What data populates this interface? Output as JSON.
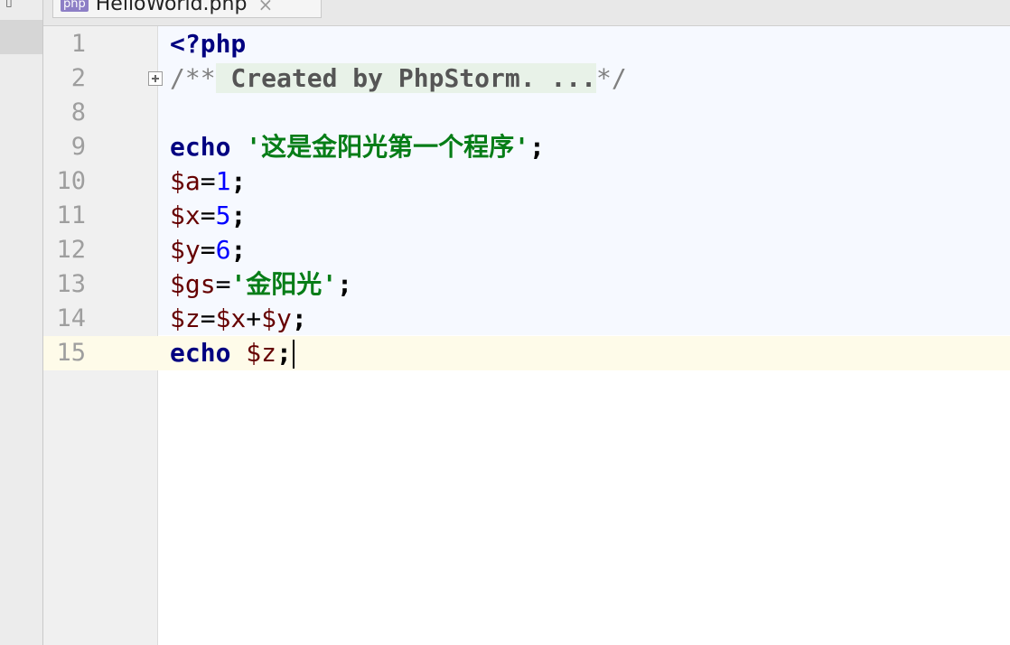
{
  "tab": {
    "icon_label": "php",
    "file_name": "HelloWorld.php",
    "close_glyph": "×"
  },
  "lines": [
    {
      "number": "1"
    },
    {
      "number": "2",
      "comment_open": "/**",
      "comment_fold": " Created by PhpStorm. ...",
      "comment_close": "*/"
    },
    {
      "number": "8"
    },
    {
      "number": "9",
      "string": "'这是金阳光第一个程序'"
    },
    {
      "number": "10",
      "value": "1"
    },
    {
      "number": "11",
      "value": "5"
    },
    {
      "number": "12",
      "value": "6"
    },
    {
      "number": "13",
      "string": "'金阳光'"
    },
    {
      "number": "14"
    },
    {
      "number": "15"
    }
  ],
  "tokens": {
    "php_open": "<?php",
    "echo": "echo",
    "semicolon": ";",
    "equals": "=",
    "plus": "+",
    "var_a": "$a",
    "var_x": "$x",
    "var_y": "$y",
    "var_gs": "$gs",
    "var_z": "$z"
  },
  "colors": {
    "keyword": "#000080",
    "variable": "#660000",
    "number": "#0000ff",
    "string": "#067d17",
    "current_line": "#fefbe9"
  }
}
